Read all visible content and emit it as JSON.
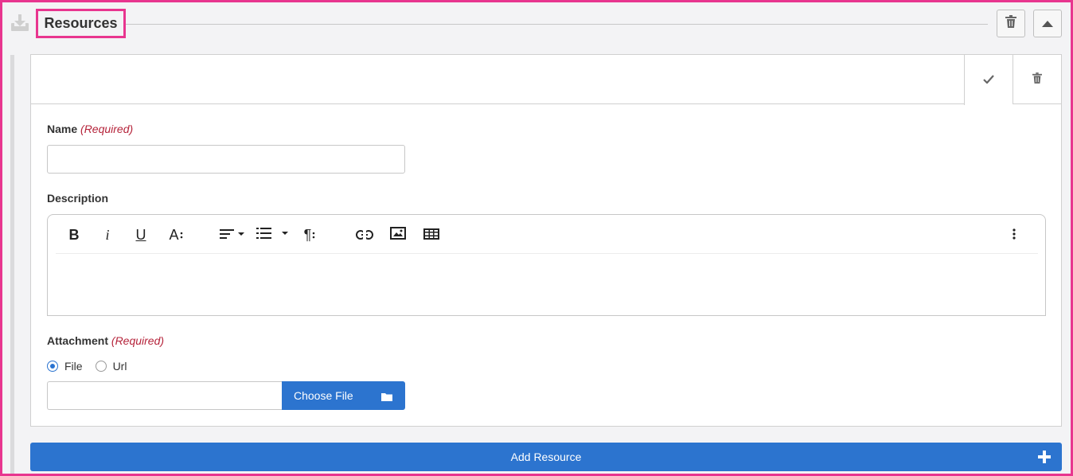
{
  "section": {
    "title": "Resources",
    "icons": {
      "download": "download-tray-icon",
      "delete": "trash-icon",
      "collapse": "caret-up-icon"
    }
  },
  "item": {
    "header_actions": {
      "confirm_icon": "check-icon",
      "delete_icon": "trash-icon"
    },
    "name": {
      "label": "Name",
      "required": "(Required)",
      "value": "",
      "placeholder": ""
    },
    "description": {
      "label": "Description",
      "toolbar": [
        "bold",
        "italic",
        "underline",
        "font-size",
        "align",
        "list",
        "paragraph-format",
        "link",
        "image",
        "table",
        "more"
      ],
      "glyphs": {
        "bold": "B",
        "italic": "i",
        "underline": "U",
        "font_size": "A",
        "paragraph": "¶"
      },
      "value": ""
    },
    "attachment": {
      "label": "Attachment",
      "required": "(Required)",
      "options": [
        "File",
        "Url"
      ],
      "selected": "File",
      "file_value": "",
      "choose_label": "Choose File"
    }
  },
  "add_button": {
    "label": "Add Resource"
  },
  "colors": {
    "accent": "#2c74cf",
    "highlight": "#e8358f",
    "required": "#b5233a"
  }
}
